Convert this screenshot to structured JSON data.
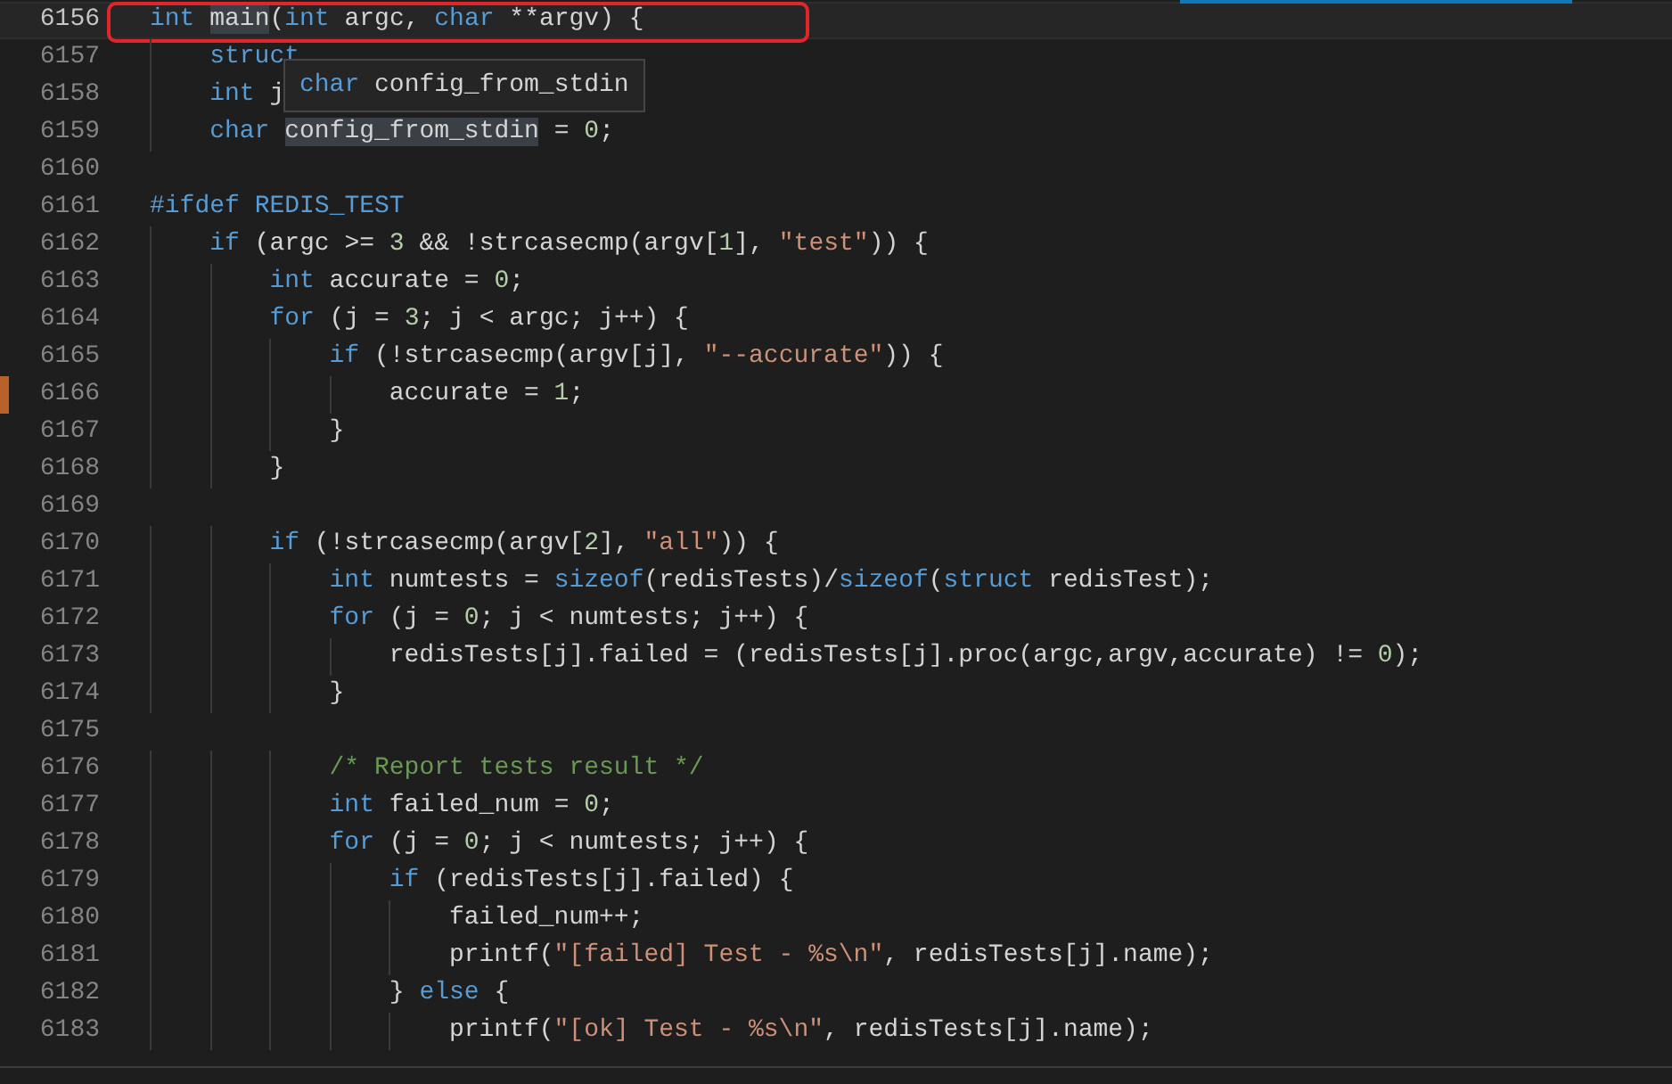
{
  "editor": {
    "lines": [
      {
        "number": "6156",
        "current": true,
        "boxed": true,
        "change_marker": false,
        "tokens": [
          {
            "kind": "kw",
            "text": "int "
          },
          {
            "kind": "match",
            "text": "main"
          },
          {
            "kind": "plain",
            "text": "("
          },
          {
            "kind": "kw",
            "text": "int"
          },
          {
            "kind": "plain",
            "text": " argc, "
          },
          {
            "kind": "kw",
            "text": "char"
          },
          {
            "kind": "plain",
            "text": " **argv) {"
          }
        ]
      },
      {
        "number": "6157",
        "current": false,
        "boxed": false,
        "change_marker": false,
        "tokens": [
          {
            "kind": "kw",
            "text": "    struct"
          }
        ]
      },
      {
        "number": "6158",
        "current": false,
        "boxed": false,
        "change_marker": false,
        "tokens": [
          {
            "kind": "kw",
            "text": "    int"
          },
          {
            "kind": "plain",
            "text": " j"
          }
        ]
      },
      {
        "number": "6159",
        "current": false,
        "boxed": false,
        "change_marker": false,
        "tokens": [
          {
            "kind": "kw",
            "text": "    char "
          },
          {
            "kind": "match",
            "text": "config_from_stdin"
          },
          {
            "kind": "plain",
            "text": " = "
          },
          {
            "kind": "num",
            "text": "0"
          },
          {
            "kind": "plain",
            "text": ";"
          }
        ]
      },
      {
        "number": "6160",
        "current": false,
        "boxed": false,
        "change_marker": false
      },
      {
        "number": "6161",
        "current": false,
        "boxed": false,
        "change_marker": false,
        "tokens": [
          {
            "kind": "kw",
            "text": "#ifdef "
          },
          {
            "kind": "macro",
            "text": "REDIS_TEST"
          }
        ]
      },
      {
        "number": "6162",
        "current": false,
        "boxed": false,
        "change_marker": false,
        "tokens": [
          {
            "kind": "kw",
            "text": "    if"
          },
          {
            "kind": "plain",
            "text": " (argc >= "
          },
          {
            "kind": "num",
            "text": "3"
          },
          {
            "kind": "plain",
            "text": " && !strcasecmp(argv["
          },
          {
            "kind": "num",
            "text": "1"
          },
          {
            "kind": "plain",
            "text": "], "
          },
          {
            "kind": "str",
            "text": "\"test\""
          },
          {
            "kind": "plain",
            "text": ")) {"
          }
        ]
      },
      {
        "number": "6163",
        "current": false,
        "boxed": false,
        "change_marker": false,
        "tokens": [
          {
            "kind": "kw",
            "text": "        int"
          },
          {
            "kind": "plain",
            "text": " accurate = "
          },
          {
            "kind": "num",
            "text": "0"
          },
          {
            "kind": "plain",
            "text": ";"
          }
        ]
      },
      {
        "number": "6164",
        "current": false,
        "boxed": false,
        "change_marker": false,
        "tokens": [
          {
            "kind": "kw",
            "text": "        for"
          },
          {
            "kind": "plain",
            "text": " (j = "
          },
          {
            "kind": "num",
            "text": "3"
          },
          {
            "kind": "plain",
            "text": "; j < argc; j++) {"
          }
        ]
      },
      {
        "number": "6165",
        "current": false,
        "boxed": false,
        "change_marker": false,
        "tokens": [
          {
            "kind": "kw",
            "text": "            if"
          },
          {
            "kind": "plain",
            "text": " (!strcasecmp(argv[j], "
          },
          {
            "kind": "str",
            "text": "\"--accurate\""
          },
          {
            "kind": "plain",
            "text": ")) {"
          }
        ]
      },
      {
        "number": "6166",
        "current": false,
        "boxed": false,
        "change_marker": true,
        "tokens": [
          {
            "kind": "plain",
            "text": "                accurate = "
          },
          {
            "kind": "num",
            "text": "1"
          },
          {
            "kind": "plain",
            "text": ";"
          }
        ]
      },
      {
        "number": "6167",
        "current": false,
        "boxed": false,
        "change_marker": false,
        "tokens": [
          {
            "kind": "plain",
            "text": "            }"
          }
        ]
      },
      {
        "number": "6168",
        "current": false,
        "boxed": false,
        "change_marker": false,
        "tokens": [
          {
            "kind": "plain",
            "text": "        }"
          }
        ]
      },
      {
        "number": "6169",
        "current": false,
        "boxed": false,
        "change_marker": false
      },
      {
        "number": "6170",
        "current": false,
        "boxed": false,
        "change_marker": false,
        "tokens": [
          {
            "kind": "kw",
            "text": "        if"
          },
          {
            "kind": "plain",
            "text": " (!strcasecmp(argv["
          },
          {
            "kind": "num",
            "text": "2"
          },
          {
            "kind": "plain",
            "text": "], "
          },
          {
            "kind": "str",
            "text": "\"all\""
          },
          {
            "kind": "plain",
            "text": ")) {"
          }
        ]
      },
      {
        "number": "6171",
        "current": false,
        "boxed": false,
        "change_marker": false,
        "tokens": [
          {
            "kind": "kw",
            "text": "            int"
          },
          {
            "kind": "plain",
            "text": " numtests = "
          },
          {
            "kind": "kw",
            "text": "sizeof"
          },
          {
            "kind": "plain",
            "text": "(redisTests)/"
          },
          {
            "kind": "kw",
            "text": "sizeof"
          },
          {
            "kind": "plain",
            "text": "("
          },
          {
            "kind": "kw",
            "text": "struct"
          },
          {
            "kind": "plain",
            "text": " redisTest);"
          }
        ]
      },
      {
        "number": "6172",
        "current": false,
        "boxed": false,
        "change_marker": false,
        "tokens": [
          {
            "kind": "kw",
            "text": "            for"
          },
          {
            "kind": "plain",
            "text": " (j = "
          },
          {
            "kind": "num",
            "text": "0"
          },
          {
            "kind": "plain",
            "text": "; j < numtests; j++) {"
          }
        ]
      },
      {
        "number": "6173",
        "current": false,
        "boxed": false,
        "change_marker": false,
        "tokens": [
          {
            "kind": "plain",
            "text": "                redisTests[j].failed = (redisTests[j].proc(argc,argv,accurate) != "
          },
          {
            "kind": "num",
            "text": "0"
          },
          {
            "kind": "plain",
            "text": ");"
          }
        ]
      },
      {
        "number": "6174",
        "current": false,
        "boxed": false,
        "change_marker": false,
        "tokens": [
          {
            "kind": "plain",
            "text": "            }"
          }
        ]
      },
      {
        "number": "6175",
        "current": false,
        "boxed": false,
        "change_marker": false
      },
      {
        "number": "6176",
        "current": false,
        "boxed": false,
        "change_marker": false,
        "tokens": [
          {
            "kind": "cmt",
            "text": "            /* Report tests result */"
          }
        ]
      },
      {
        "number": "6177",
        "current": false,
        "boxed": false,
        "change_marker": false,
        "tokens": [
          {
            "kind": "kw",
            "text": "            int"
          },
          {
            "kind": "plain",
            "text": " failed_num = "
          },
          {
            "kind": "num",
            "text": "0"
          },
          {
            "kind": "plain",
            "text": ";"
          }
        ]
      },
      {
        "number": "6178",
        "current": false,
        "boxed": false,
        "change_marker": false,
        "tokens": [
          {
            "kind": "kw",
            "text": "            for"
          },
          {
            "kind": "plain",
            "text": " (j = "
          },
          {
            "kind": "num",
            "text": "0"
          },
          {
            "kind": "plain",
            "text": "; j < numtests; j++) {"
          }
        ]
      },
      {
        "number": "6179",
        "current": false,
        "boxed": false,
        "change_marker": false,
        "tokens": [
          {
            "kind": "kw",
            "text": "                if"
          },
          {
            "kind": "plain",
            "text": " (redisTests[j].failed) {"
          }
        ]
      },
      {
        "number": "6180",
        "current": false,
        "boxed": false,
        "change_marker": false,
        "tokens": [
          {
            "kind": "plain",
            "text": "                    failed_num++;"
          }
        ]
      },
      {
        "number": "6181",
        "current": false,
        "boxed": false,
        "change_marker": false,
        "tokens": [
          {
            "kind": "plain",
            "text": "                    printf("
          },
          {
            "kind": "str",
            "text": "\"[failed] Test - %s\\n\""
          },
          {
            "kind": "plain",
            "text": ", redisTests[j].name);"
          }
        ]
      },
      {
        "number": "6182",
        "current": false,
        "boxed": false,
        "change_marker": false,
        "tokens": [
          {
            "kind": "plain",
            "text": "                } "
          },
          {
            "kind": "kw",
            "text": "else"
          },
          {
            "kind": "plain",
            "text": " {"
          }
        ]
      },
      {
        "number": "6183",
        "current": false,
        "boxed": false,
        "change_marker": false,
        "tokens": [
          {
            "kind": "plain",
            "text": "                    printf("
          },
          {
            "kind": "str",
            "text": "\"[ok] Test - %s\\n\""
          },
          {
            "kind": "plain",
            "text": ", redisTests[j].name);"
          }
        ]
      }
    ]
  },
  "hover_tooltip": {
    "tokens": [
      {
        "kind": "kw",
        "text": "char"
      },
      {
        "kind": "plain",
        "text": " config_from_stdin"
      }
    ]
  }
}
